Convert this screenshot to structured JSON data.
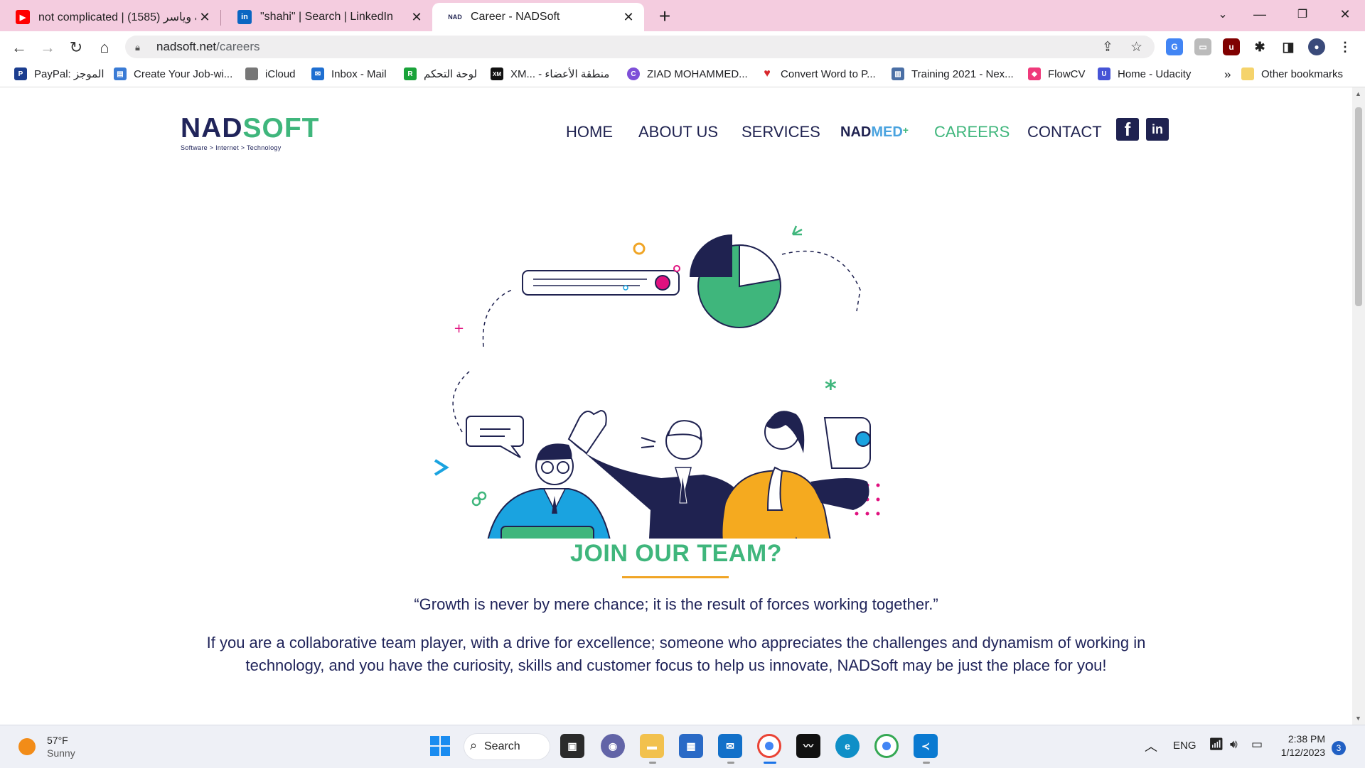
{
  "browser": {
    "tabs": [
      {
        "title": "not complicated | اية وياسر (1585)",
        "favicon": "youtube-icon",
        "active": false
      },
      {
        "title": "\"shahi\" | Search | LinkedIn",
        "favicon": "linkedin-icon",
        "active": false
      },
      {
        "title": "Career - NADSoft",
        "favicon": "NAD",
        "active": true
      }
    ],
    "url_host": "nadsoft.net",
    "url_path": "/careers",
    "bookmarks": [
      {
        "label": "PayPal: الموجز",
        "icon": "paypal-icon",
        "color": "#1b3d8f"
      },
      {
        "label": "Create Your Job-wi...",
        "icon": "page-icon",
        "color": "#3a7bd5"
      },
      {
        "label": "iCloud",
        "icon": "apple-icon",
        "color": "#777777"
      },
      {
        "label": "Inbox - Mail",
        "icon": "mail-icon",
        "color": "#1f6fd1"
      },
      {
        "label": "لوحة التحكم",
        "icon": "rbs-icon",
        "color": "#1aa33a"
      },
      {
        "label": "XM... - منطقة الأعضاء",
        "icon": "xm-icon",
        "color": "#111111"
      },
      {
        "label": "ZIAD MOHAMMED...",
        "icon": "canva-icon",
        "color": "#7e4fd8"
      },
      {
        "label": "Convert Word to P...",
        "icon": "heart-icon",
        "color": "#d8262b"
      },
      {
        "label": "Training 2021 - Nex...",
        "icon": "chart-icon",
        "color": "#4a6fa5"
      },
      {
        "label": "FlowCV",
        "icon": "flowcv-icon",
        "color": "#ef3a7b"
      },
      {
        "label": "Home - Udacity",
        "icon": "udacity-icon",
        "color": "#4654d6"
      }
    ],
    "bookmarks_more": "»",
    "other_bookmarks": "Other bookmarks"
  },
  "site": {
    "logo_nad": "NAD",
    "logo_soft": "SOFT",
    "logo_tagline": "Software   > Internet   > Technology",
    "nav": [
      {
        "label": "HOME",
        "active": false
      },
      {
        "label": "ABOUT US",
        "active": false
      },
      {
        "label": "SERVICES",
        "active": false
      },
      {
        "label": "CAREERS",
        "active": true
      },
      {
        "label": "CONTACT",
        "active": false
      }
    ],
    "nadmed_nad": "NAD",
    "nadmed_med": "MED",
    "social": [
      "facebook-icon",
      "linkedin-icon"
    ],
    "heading": "JOIN OUR TEAM?",
    "quote": "“Growth is never by mere chance; it is the result of forces working together.”",
    "paragraph": "If you are a collaborative team player, with a drive for excellence; someone who appreciates the challenges and dynamism of working in technology, and you have the curiosity, skills and customer focus to help us innovate, NADSoft may be just the place for you!",
    "colors": {
      "navy": "#1f2250",
      "green": "#3fb67c",
      "orange": "#f0a526",
      "pink": "#e0117f",
      "blue": "#1aa3e0"
    }
  },
  "taskbar": {
    "weather_temp": "57°F",
    "weather_desc": "Sunny",
    "search_label": "Search",
    "lang": "ENG",
    "time": "2:38 PM",
    "date": "1/12/2023",
    "notifications": "3"
  }
}
